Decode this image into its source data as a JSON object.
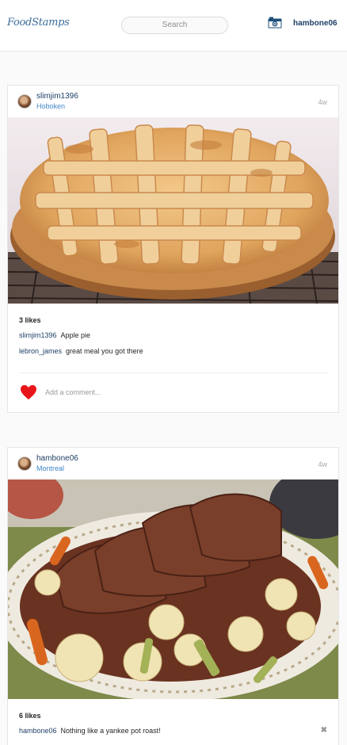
{
  "header": {
    "logo": "FoodStamps",
    "search_placeholder": "Search",
    "camera_icon": "camera-icon",
    "username": "hambone06"
  },
  "posts": [
    {
      "user": "slimjim1396",
      "location": "Hoboken",
      "time": "4w",
      "photo": "apple-pie-photo",
      "likes": "3 likes",
      "comments": [
        {
          "user": "slimjim1396",
          "text": "Apple pie"
        },
        {
          "user": "lebron_james",
          "text": "great meal you got there"
        }
      ],
      "heart_icon": "heart-icon",
      "heart_color": "#e8151b",
      "add_comment_placeholder": "Add a comment..."
    },
    {
      "user": "hambone06",
      "location": "Montreal",
      "time": "4w",
      "photo": "pot-roast-photo",
      "likes": "6 likes",
      "comments": [
        {
          "user": "hambone06",
          "text": "Nothing like a yankee pot roast!"
        }
      ],
      "delete_icon": "close-icon",
      "delete_glyph": "✖"
    }
  ]
}
